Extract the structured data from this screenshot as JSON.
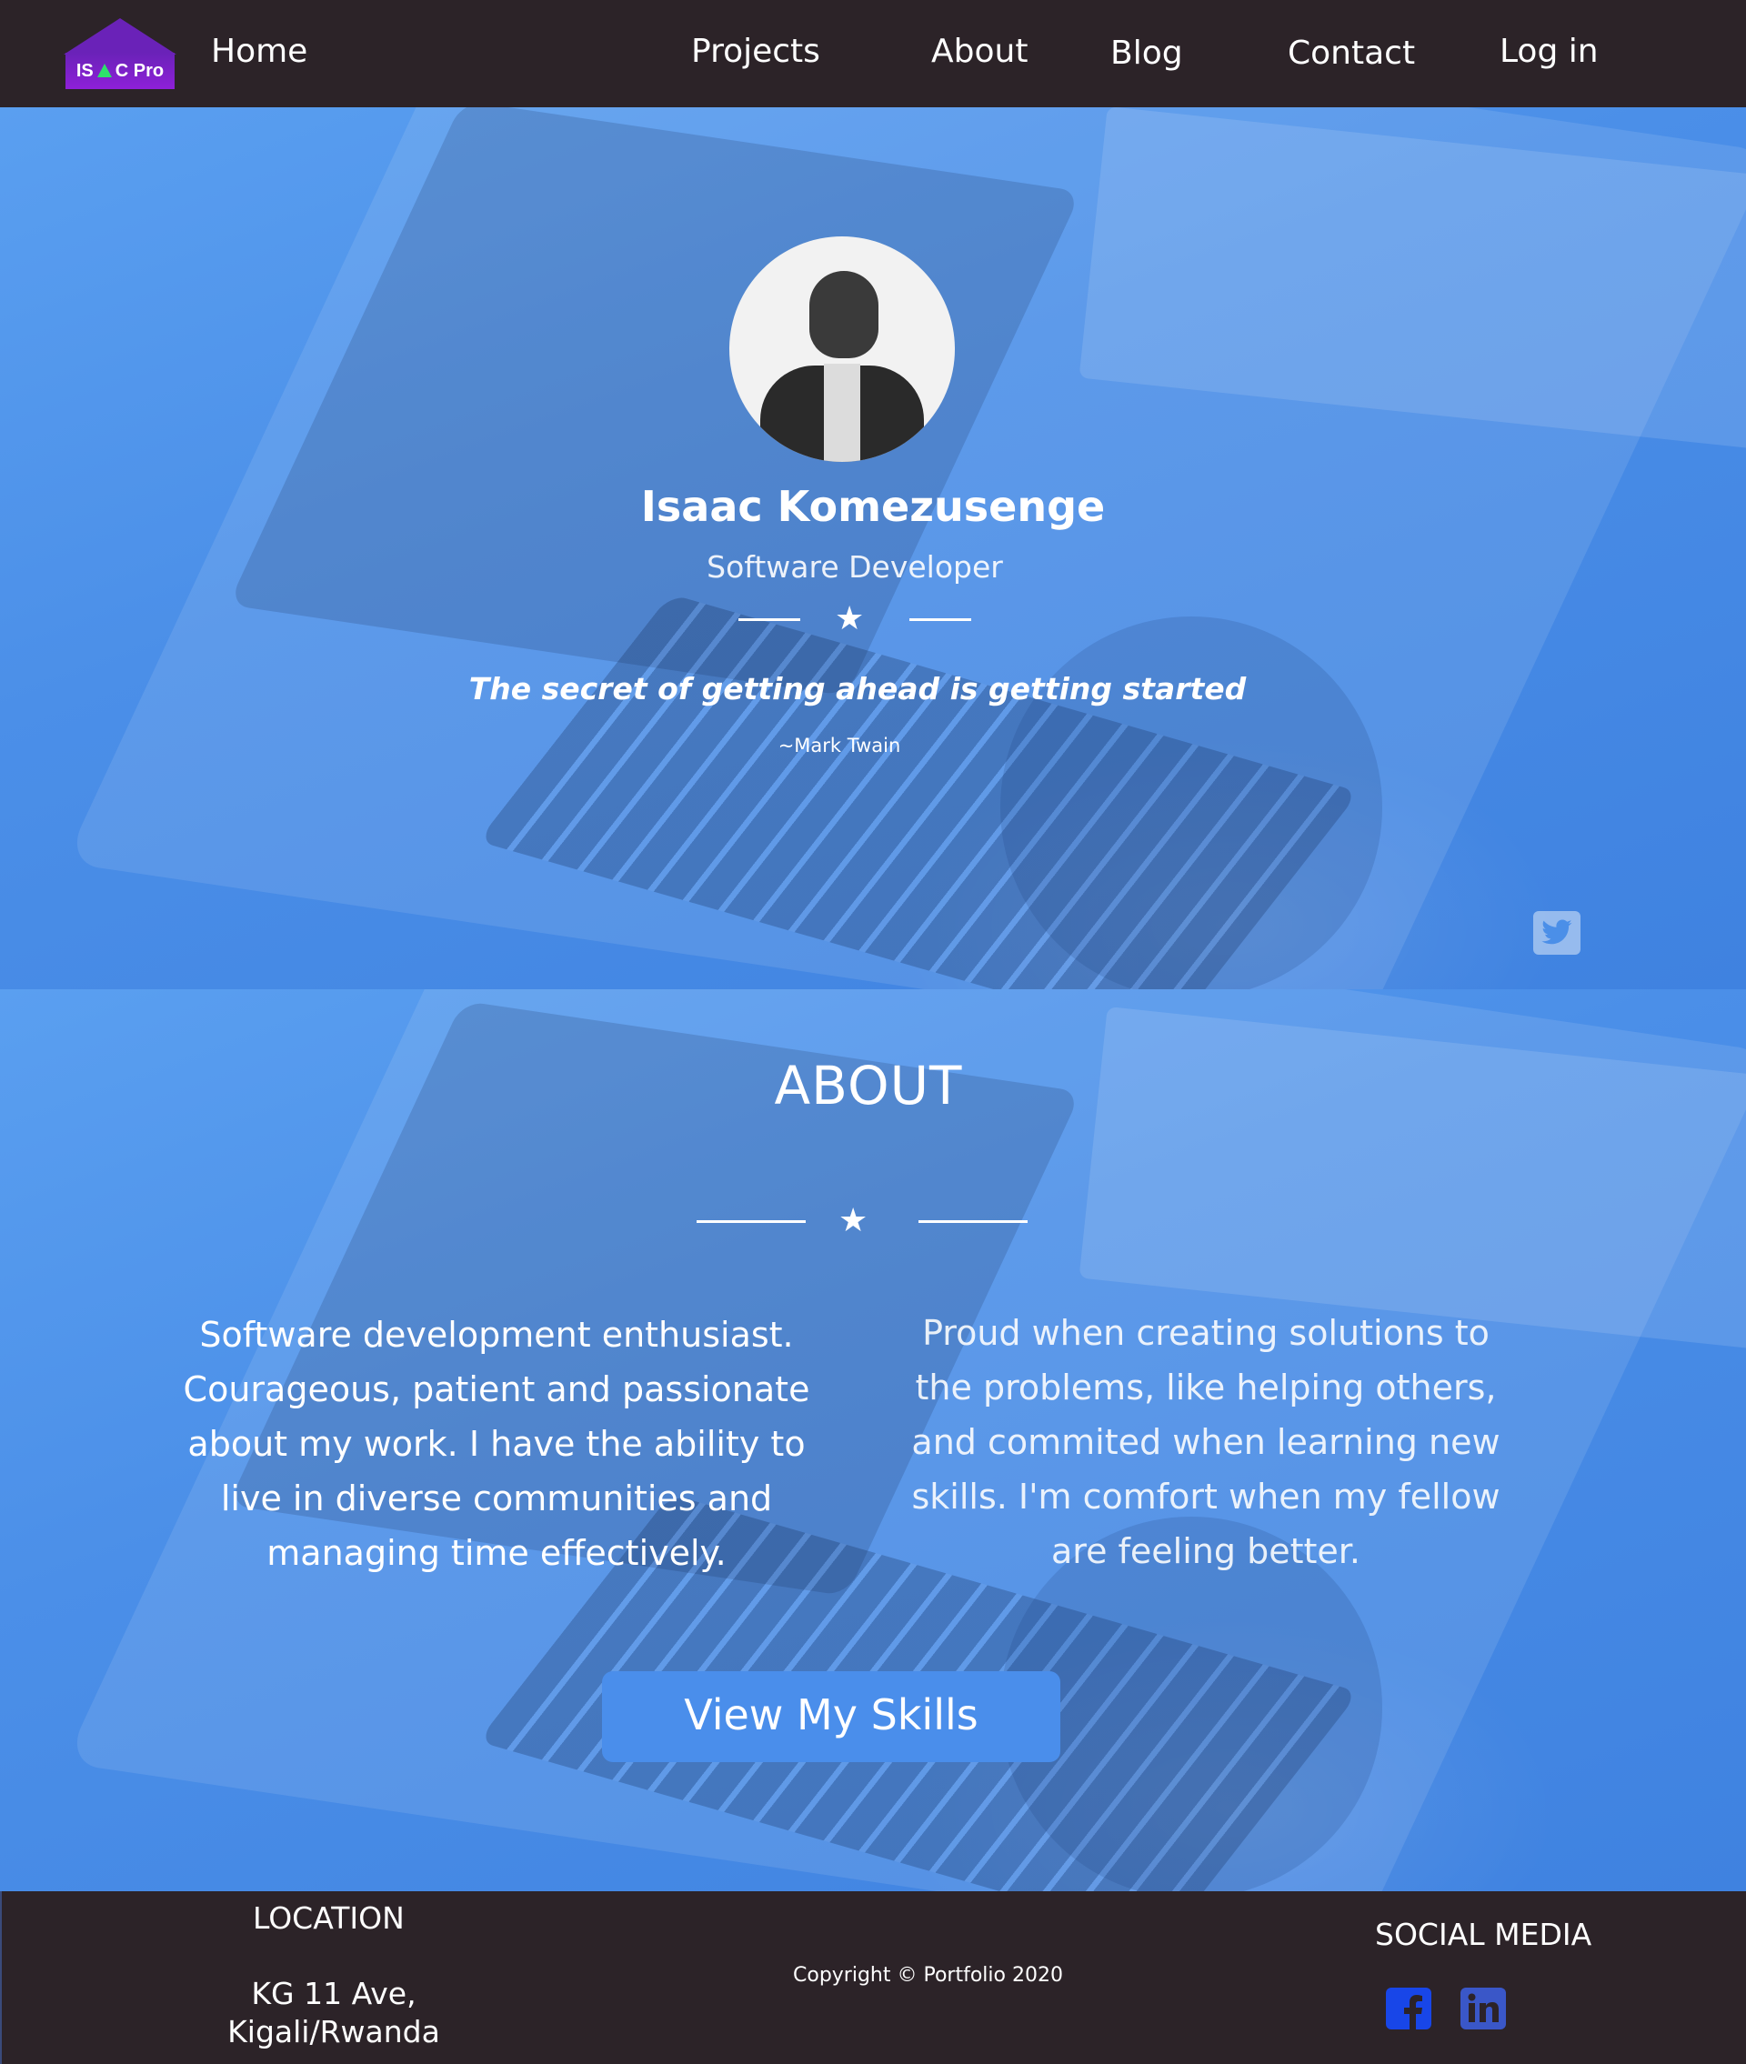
{
  "nav": {
    "logo_left": "IS",
    "logo_right": "C Pro",
    "links": [
      "Home",
      "Projects",
      "About",
      "Blog",
      "Contact",
      "Log in"
    ]
  },
  "hero": {
    "name": "Isaac Komezusenge",
    "role": "Software Developer",
    "divider_icon": "★",
    "quote": "The secret of getting ahead is getting started",
    "author": "~Mark Twain",
    "avatar_icon": "avatar-photo",
    "social_icon": "twitter-icon"
  },
  "about": {
    "title": "ABOUT",
    "divider_icon": "★",
    "left_lines": [
      "Software development  enthusiast.",
      "Courageous, patient and passionate",
      "about my work. I have the ability to",
      "live in diverse communities and",
      "managing time effectively."
    ],
    "right_lines": [
      "Proud when creating solutions to",
      "the problems, like helping others,",
      "and commited when learning new",
      "skills. I'm comfort when my fellow",
      "are feeling better."
    ],
    "button_label": "View My Skills"
  },
  "footer": {
    "location_title": "LOCATION",
    "address_line1": "KG 11 Ave,",
    "address_line2": "Kigali/Rwanda",
    "copyright": "Copyright © Portfolio 2020",
    "social_title": "SOCIAL MEDIA",
    "social_icons": [
      "facebook-icon",
      "linkedin-icon"
    ]
  },
  "colors": {
    "nav_bg": "#2c2328",
    "overlay_blue": "#4b8fe8",
    "logo_purple": "#6a22b8",
    "facebook_blue": "#1846e8",
    "linkedin_blue": "#3a57c8"
  }
}
